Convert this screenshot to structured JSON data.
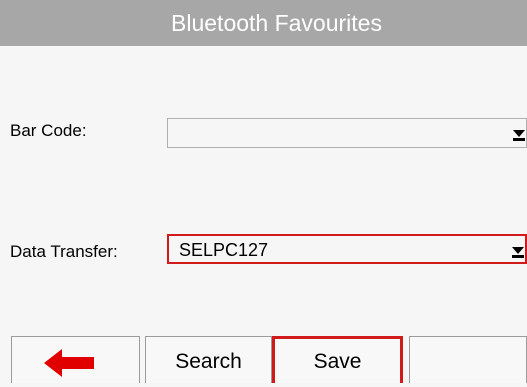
{
  "window": {
    "title": "Bluetooth Favourites"
  },
  "form": {
    "barcode": {
      "label": "Bar Code:",
      "value": ""
    },
    "data_transfer": {
      "label": "Data Transfer:",
      "value": "SELPC127"
    }
  },
  "toolbar": {
    "back_icon": "left-arrow-icon",
    "search_label": "Search",
    "save_label": "Save",
    "extra_label": ""
  },
  "colors": {
    "accent": "#d11a1a",
    "titlebar": "#a7a7a7"
  }
}
